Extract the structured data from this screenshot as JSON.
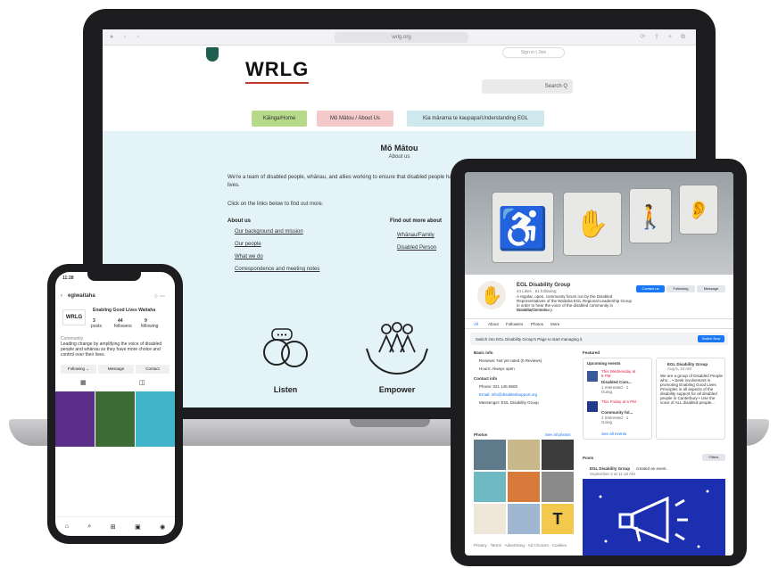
{
  "laptop": {
    "url": "wrlg.org",
    "signin": "Sign in | Join",
    "logo": "WRLG",
    "search": "Search Q",
    "nav": [
      "Kāinga/Home",
      "Mō Mātou / About Us",
      "Kia mārama te kaupapa/Understanding EGL"
    ],
    "title": "Mō Mātou",
    "subtitle": "About us",
    "intro": "We're a team of disabled people, whānau, and allies working to ensure that disabled people have choice and control in their lives.",
    "click_text": "Click on the links below to find out more.",
    "about_head": "About us",
    "about_links": [
      "Our background and mission",
      "Our people",
      "What we do",
      "Correspondence and meeting notes"
    ],
    "find_head": "Find out more about",
    "find_links": [
      "Whānau/Family",
      "Disabled Person"
    ],
    "features": [
      "Listen",
      "Empower"
    ]
  },
  "phone": {
    "time": "11:28",
    "handle": "egiwaitaha",
    "name": "Enabling Good Lives Waitaha",
    "stats": [
      {
        "n": "3",
        "l": "posts"
      },
      {
        "n": "44",
        "l": "followers"
      },
      {
        "n": "9",
        "l": "following"
      }
    ],
    "category": "Community",
    "bio": "Leading change by amplifying the voice of disabled people and whānau so they have more choice and control over their lives.",
    "buttons": [
      "Following ⌄",
      "Message",
      "Contact"
    ]
  },
  "tablet": {
    "page_name": "EGL Disability Group",
    "page_meta": "44 Likes · 51 following",
    "page_desc": "A regular, open, community forum run by the Disabled Representatives of the Waitaha EGL Regional Leadership Group in order to hear the voice of the disabled community in Waitaha/Canterbury.",
    "tags": "Disability Service",
    "actions": [
      "Contact us",
      "Following",
      "Message"
    ],
    "tabs": [
      "All",
      "About",
      "Followers",
      "Photos",
      "More"
    ],
    "switch_prompt": "Switch into EGL Disability Group's Page to start managing it.",
    "switch_btn": "Switch Now",
    "intro_head": "Basic info",
    "intro_rows": [
      "Reviews: Not yet rated (0 Reviews)",
      "Hours: Always open"
    ],
    "contact_head": "Contact info",
    "contact_rows": [
      "Phone: 021 145 9600",
      "Email: info@disabledsupport.org",
      "Messenger: EGL Disability Group"
    ],
    "photos_head": "Photos",
    "photos_link": "See all photos",
    "featured_head": "Featured",
    "events_head": "Upcoming events",
    "event1": {
      "day": "This Wednesday at 6 PM",
      "title": "Disabled Com...",
      "place": "1 Interested · 1 Going"
    },
    "event2": {
      "day": "This Friday at 6 PM",
      "title": "Community fol...",
      "place": "1 Interested · 1 Going"
    },
    "see_all_events": "See all events",
    "post_author": "EGL Disability Group",
    "post_date": "Aug 5, 10 AM",
    "post_text": "We are a group of Disabled People who... • Seek involvement in promoting Enabling Good Lives Principles in all aspects of the disability support for all disabled people in Canterbury • Use the voice of ALL disabled people...",
    "posts_head": "Posts",
    "filters": "Filters",
    "post2_author": "EGL Disability Group",
    "post2_action": "created an event.",
    "post2_date": "September 2 at 11:18 AM",
    "footer": "Privacy · Terms · Advertising · Ad Choices · Cookies"
  }
}
